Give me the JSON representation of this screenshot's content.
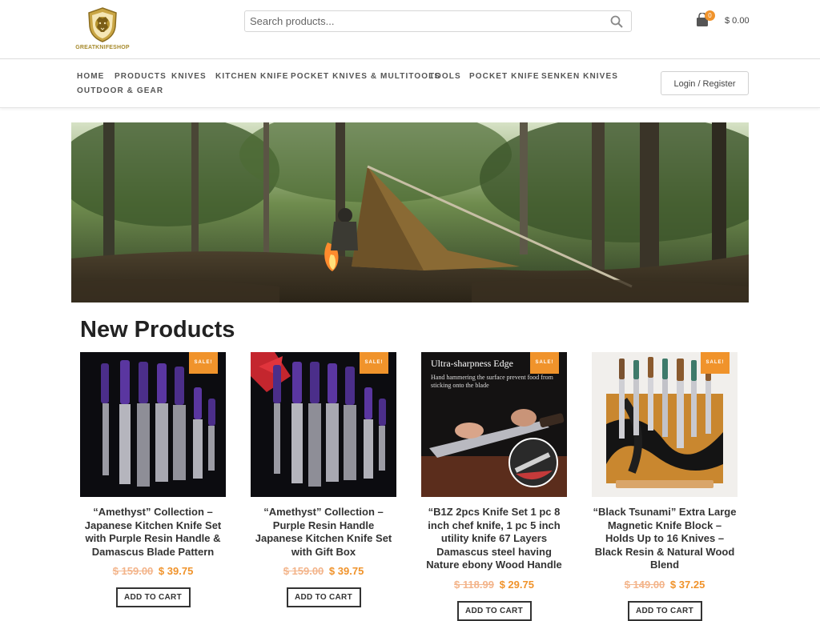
{
  "brand": {
    "logo_text": "GREATKNIFESHOP"
  },
  "search": {
    "placeholder": "Search products..."
  },
  "cart": {
    "count": "0",
    "total": "$ 0.00"
  },
  "nav": {
    "items": [
      "HOME",
      "PRODUCTS",
      "KNIVES",
      "KITCHEN KNIFE",
      "POCKET KNIVES & MULTITOOLS",
      "TOOLS",
      "POCKET KNIFE",
      "SENKEN KNIVES",
      "OUTDOOR & GEAR"
    ],
    "login_label": "Login / Register"
  },
  "section": {
    "title": "New Products"
  },
  "products": [
    {
      "title": "“Amethyst” Collection – Japanese Kitchen Knife Set with Purple Resin Handle & Damascus Blade Pattern",
      "old_price": "$ 159.00",
      "price": "$ 39.75",
      "badge": "SALE!",
      "button": "ADD TO CART"
    },
    {
      "title": "“Amethyst” Collection – Purple Resin Handle Japanese Kitchen Knife Set with Gift Box",
      "old_price": "$ 159.00",
      "price": "$ 39.75",
      "badge": "SALE!",
      "button": "ADD TO CART"
    },
    {
      "title": "“B1Z 2pcs Knife Set 1 pc 8 inch chef knife, 1 pc 5 inch utility knife 67 Layers Damascus steel having Nature ebony Wood Handle",
      "old_price": "$ 118.99",
      "price": "$ 29.75",
      "badge": "SALE!",
      "button": "ADD TO CART",
      "image_caption": "Ultra-sharpness Edge",
      "image_subcaption": "Hand hammering the surface prevent food from sticking onto the blade"
    },
    {
      "title": "“Black Tsunami” Extra Large Magnetic Knife Block – Holds Up to 16 Knives – Black Resin & Natural Wood Blend",
      "old_price": "$ 149.00",
      "price": "$ 37.25",
      "badge": "SALE!",
      "button": "ADD TO CART"
    }
  ],
  "colors": {
    "accent": "#f0932b",
    "old_price": "#f3b48a",
    "logo_gold": "#b8952f"
  }
}
